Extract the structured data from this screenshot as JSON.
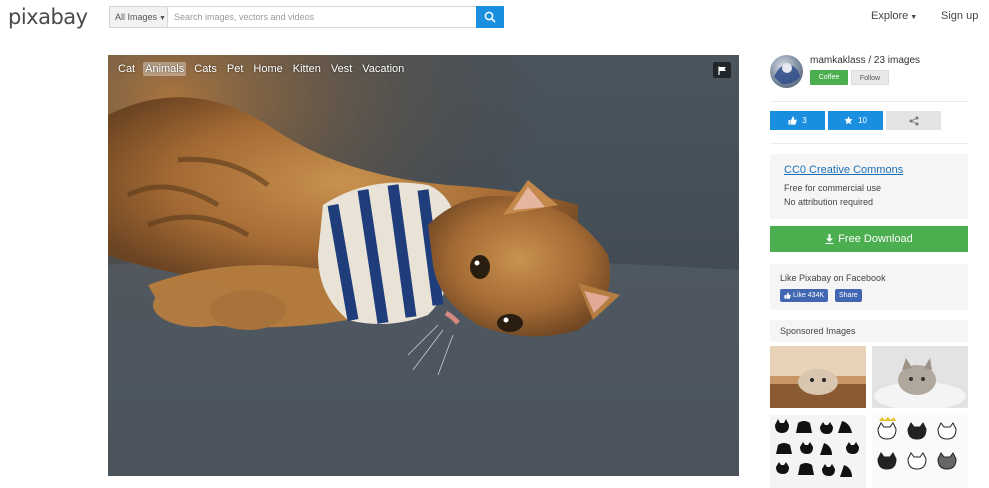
{
  "header": {
    "logo": "pixabay",
    "search_filter": "All Images",
    "search_placeholder": "Search images, vectors and videos",
    "explore_label": "Explore",
    "signup_label": "Sign up"
  },
  "photo": {
    "tags": [
      "Cat",
      "Animals",
      "Cats",
      "Pet",
      "Home",
      "Kitten",
      "Vest",
      "Vacation"
    ],
    "active_tag": "Animals"
  },
  "author": {
    "name_line": "mamkaklass / 23 images",
    "coffee_label": "Coffee",
    "follow_label": "Follow"
  },
  "stats": {
    "likes": "3",
    "favorites": "10"
  },
  "license": {
    "title": "CC0 Creative Commons",
    "line1": "Free for commercial use",
    "line2": "No attribution required"
  },
  "download": {
    "label": "Free Download"
  },
  "facebook": {
    "text": "Like Pixabay on Facebook",
    "like_label": "Like 434K",
    "share_label": "Share"
  },
  "sponsored": {
    "title": "Sponsored Images"
  },
  "colors": {
    "accent_blue": "#1a8fe0",
    "download_green": "#4bae4f",
    "facebook_blue": "#4267b2",
    "link_blue": "#1a6fb8"
  }
}
